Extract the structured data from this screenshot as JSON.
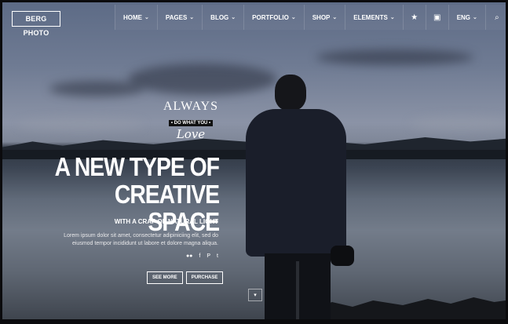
{
  "header": {
    "logo_text": "BERG PHOTO",
    "nav": [
      {
        "label": "HOME"
      },
      {
        "label": "PAGES"
      },
      {
        "label": "BLOG"
      },
      {
        "label": "PORTFOLIO"
      },
      {
        "label": "SHOP"
      },
      {
        "label": "ELEMENTS"
      }
    ],
    "icons": {
      "favorites": "★",
      "cart": "▣",
      "language": "ENG",
      "search": "⌕",
      "close": "✕"
    }
  },
  "hero": {
    "tagline_top": "ALWAYS",
    "tagline_mid": "• DO WHAT YOU •",
    "tagline_bottom": "Love",
    "headline_line1": "A NEW TYPE OF",
    "headline_line2": "CREATIVE SPACE",
    "subheading": "WITH A CRAP OF NATURAL LIGHT",
    "body_line1": "Lorem ipsum dolor sit amet, consectetur adipiniciing elit, sed do",
    "body_line2": "eiusmod tempor incididunt ut labore et dolore magna aliqua.",
    "social_icons": [
      "flickr",
      "facebook",
      "pinterest",
      "twitter"
    ],
    "buttons": {
      "see_more": "SEE MORE",
      "purchase": "PURCHASE"
    },
    "scroll_icon": "▾"
  }
}
